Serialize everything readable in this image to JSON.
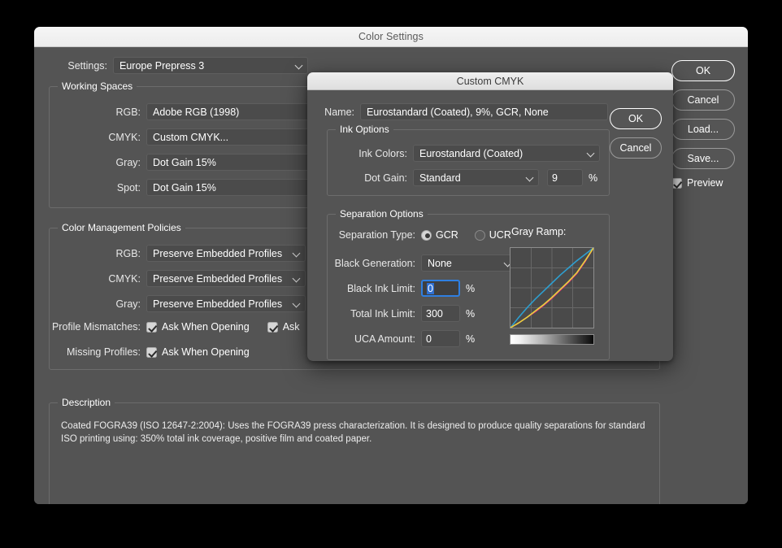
{
  "window": {
    "title": "Color Settings"
  },
  "settings": {
    "label": "Settings:",
    "value": "Europe Prepress 3"
  },
  "working_spaces": {
    "title": "Working Spaces",
    "rows": [
      {
        "label": "RGB:",
        "value": "Adobe RGB (1998)"
      },
      {
        "label": "CMYK:",
        "value": "Custom CMYK..."
      },
      {
        "label": "Gray:",
        "value": "Dot Gain 15%"
      },
      {
        "label": "Spot:",
        "value": "Dot Gain 15%"
      }
    ]
  },
  "color_management_policies": {
    "title": "Color Management Policies",
    "rows": [
      {
        "label": "RGB:",
        "value": "Preserve Embedded Profiles"
      },
      {
        "label": "CMYK:",
        "value": "Preserve Embedded Profiles"
      },
      {
        "label": "Gray:",
        "value": "Preserve Embedded Profiles"
      }
    ],
    "profile_mismatches_label": "Profile Mismatches:",
    "profile_mismatches_check1": "Ask When Opening",
    "profile_mismatches_check2": "Ask",
    "missing_profiles_label": "Missing Profiles:",
    "missing_profiles_check1": "Ask When Opening"
  },
  "description": {
    "title": "Description",
    "text": "Coated FOGRA39 (ISO 12647-2:2004):  Uses the FOGRA39 press characterization. It is designed to produce quality separations for standard ISO printing using: 350% total ink coverage, positive film and coated paper."
  },
  "side_buttons": {
    "ok": "OK",
    "cancel": "Cancel",
    "load": "Load...",
    "save": "Save...",
    "preview": "Preview"
  },
  "modal": {
    "title": "Custom CMYK",
    "name_label": "Name:",
    "name_value": "Eurostandard (Coated), 9%, GCR, None",
    "ok": "OK",
    "cancel": "Cancel",
    "ink_options": {
      "title": "Ink Options",
      "ink_colors_label": "Ink Colors:",
      "ink_colors_value": "Eurostandard (Coated)",
      "dot_gain_label": "Dot Gain:",
      "dot_gain_value": "Standard",
      "dot_gain_amount": "9",
      "dot_gain_unit": "%"
    },
    "separation_options": {
      "title": "Separation Options",
      "separation_type_label": "Separation Type:",
      "gcr_label": "GCR",
      "ucr_label": "UCR",
      "selected_separation": "GCR",
      "black_generation_label": "Black Generation:",
      "black_generation_value": "None",
      "black_ink_limit_label": "Black Ink Limit:",
      "black_ink_limit_value": "0",
      "total_ink_limit_label": "Total Ink Limit:",
      "total_ink_limit_value": "300",
      "uca_amount_label": "UCA Amount:",
      "uca_amount_value": "0",
      "unit": "%",
      "gray_ramp_label": "Gray Ramp:"
    }
  },
  "chart_data": {
    "type": "line",
    "title": "Gray Ramp",
    "xlabel": "",
    "ylabel": "",
    "xlim": [
      0,
      100
    ],
    "ylim": [
      0,
      100
    ],
    "grid": true,
    "grid_divisions": 4,
    "legend": "none",
    "x": [
      0,
      10,
      20,
      30,
      40,
      50,
      60,
      70,
      80,
      90,
      100
    ],
    "series": [
      {
        "name": "Cyan",
        "color": "#2e9fd0",
        "values": [
          0,
          13,
          25,
          36,
          46,
          56,
          66,
          75,
          84,
          92,
          100
        ]
      },
      {
        "name": "Magenta",
        "color": "#e5287f",
        "values": [
          0,
          6,
          13,
          20,
          28,
          37,
          47,
          57,
          68,
          83,
          100
        ]
      },
      {
        "name": "Yellow",
        "color": "#e8d43c",
        "values": [
          0,
          6,
          13,
          21,
          29,
          38,
          48,
          58,
          69,
          84,
          100
        ]
      }
    ],
    "gradient_bar": {
      "from": "#ffffff",
      "to": "#000000",
      "direction": "left-to-right"
    }
  }
}
